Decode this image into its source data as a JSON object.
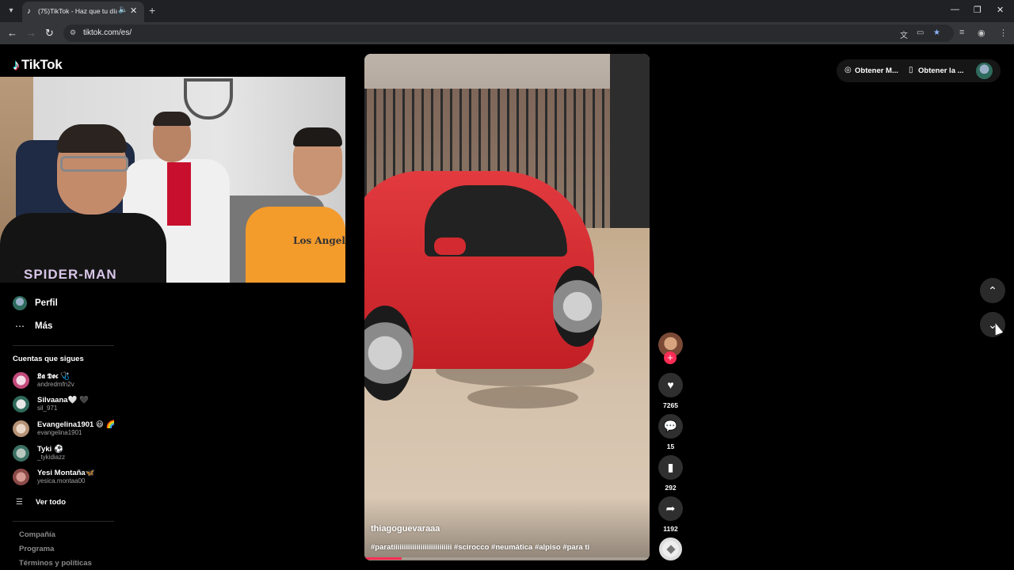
{
  "browser": {
    "tab_title": "(75)TikTok - Haz que tu día",
    "url": "tiktok.com/es/"
  },
  "tiktok": {
    "logo_text": "TikTok",
    "nav": [
      {
        "label": "Perfil"
      },
      {
        "label": "Más"
      }
    ],
    "following_title": "Cuentas que sigues",
    "following": [
      {
        "name": "𝕷𝖆 𝕯𝖔𝖈 🩺",
        "username": "andredmfn2v"
      },
      {
        "name": "Silvaana🤍 🖤",
        "username": "sil_971"
      },
      {
        "name": "Evangelina1901 😃 🌈",
        "username": "evangelina1901"
      },
      {
        "name": "Tyki ⚽",
        "username": "_tykidiazz"
      },
      {
        "name": "Yesi Montaña🦋",
        "username": "yesica.montaa00"
      }
    ],
    "see_all": "Ver todo",
    "footer": [
      "Compañía",
      "Programa",
      "Términos y políticas"
    ],
    "top_actions": {
      "get_coins": "Obtener M...",
      "get_app": "Obtener la ..."
    },
    "video": {
      "author": "thiagoguevaraaa",
      "caption": "#paratiiiiiiiiiiiiiiiiiiiiiiiiiiii #scirocco #neumática #alpiso #para ti",
      "progress": 0.13
    },
    "actions": {
      "likes": "7265",
      "comments": "15",
      "saves": "292",
      "shares": "1192"
    },
    "webcam": {
      "shirt_print": "SPIDER-MAN",
      "orange_print": "Los Angel"
    }
  }
}
